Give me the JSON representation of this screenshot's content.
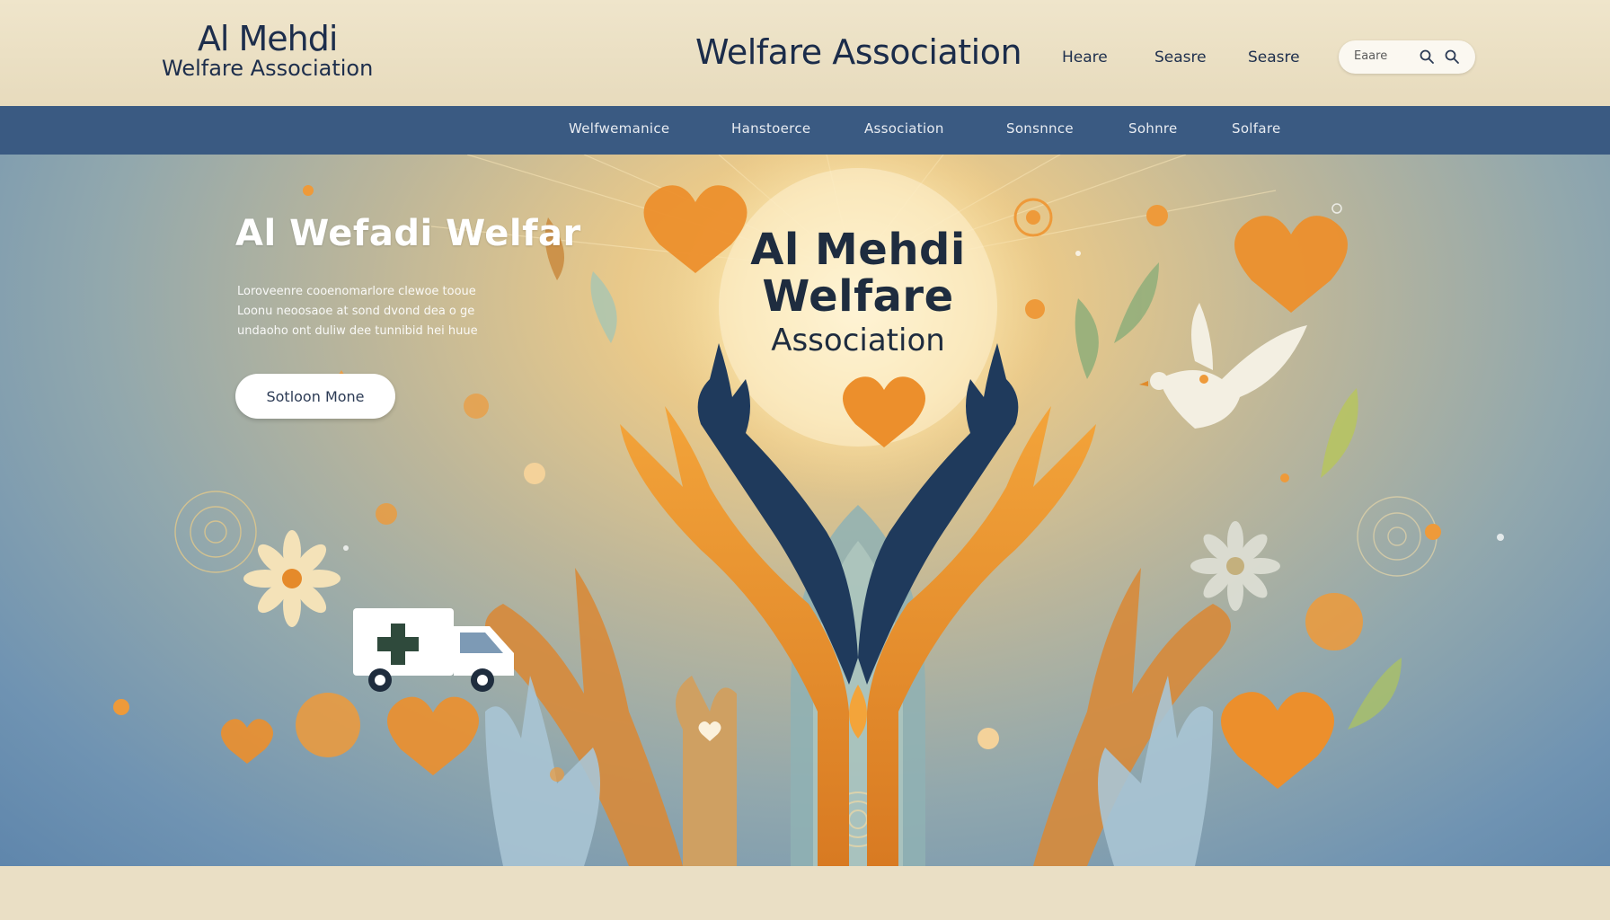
{
  "header": {
    "logo_line1": "Al Mehdi",
    "logo_line2": "Welfare Association",
    "title": "Welfare Association",
    "links": [
      "Heare",
      "Seasre",
      "Seasre"
    ],
    "search": {
      "placeholder": "Eaare"
    }
  },
  "nav": {
    "items": [
      "Welfwemanice",
      "Hanstoerce",
      "Association",
      "Sonsnnce",
      "Sohnre",
      "Solfare"
    ]
  },
  "hero": {
    "heading": "Al Wefadi  Welfar",
    "body_lines": [
      "Loroveenre cooenomarlore clewoe tooue",
      "Loonu neoosaoe at sond dvond dea o ge",
      "undaoho ont duliw dee tunnibid hei huue"
    ],
    "cta_label": "Sotloon Mone",
    "center_title_line1": "Al Mehdi",
    "center_title_line2": "Welfare",
    "center_title_line3": "Association"
  },
  "colors": {
    "navbar": "#3a5a82",
    "header_bg": "#ece1c4",
    "accent_orange": "#e8912e",
    "dark_navy": "#1d2e4c"
  }
}
